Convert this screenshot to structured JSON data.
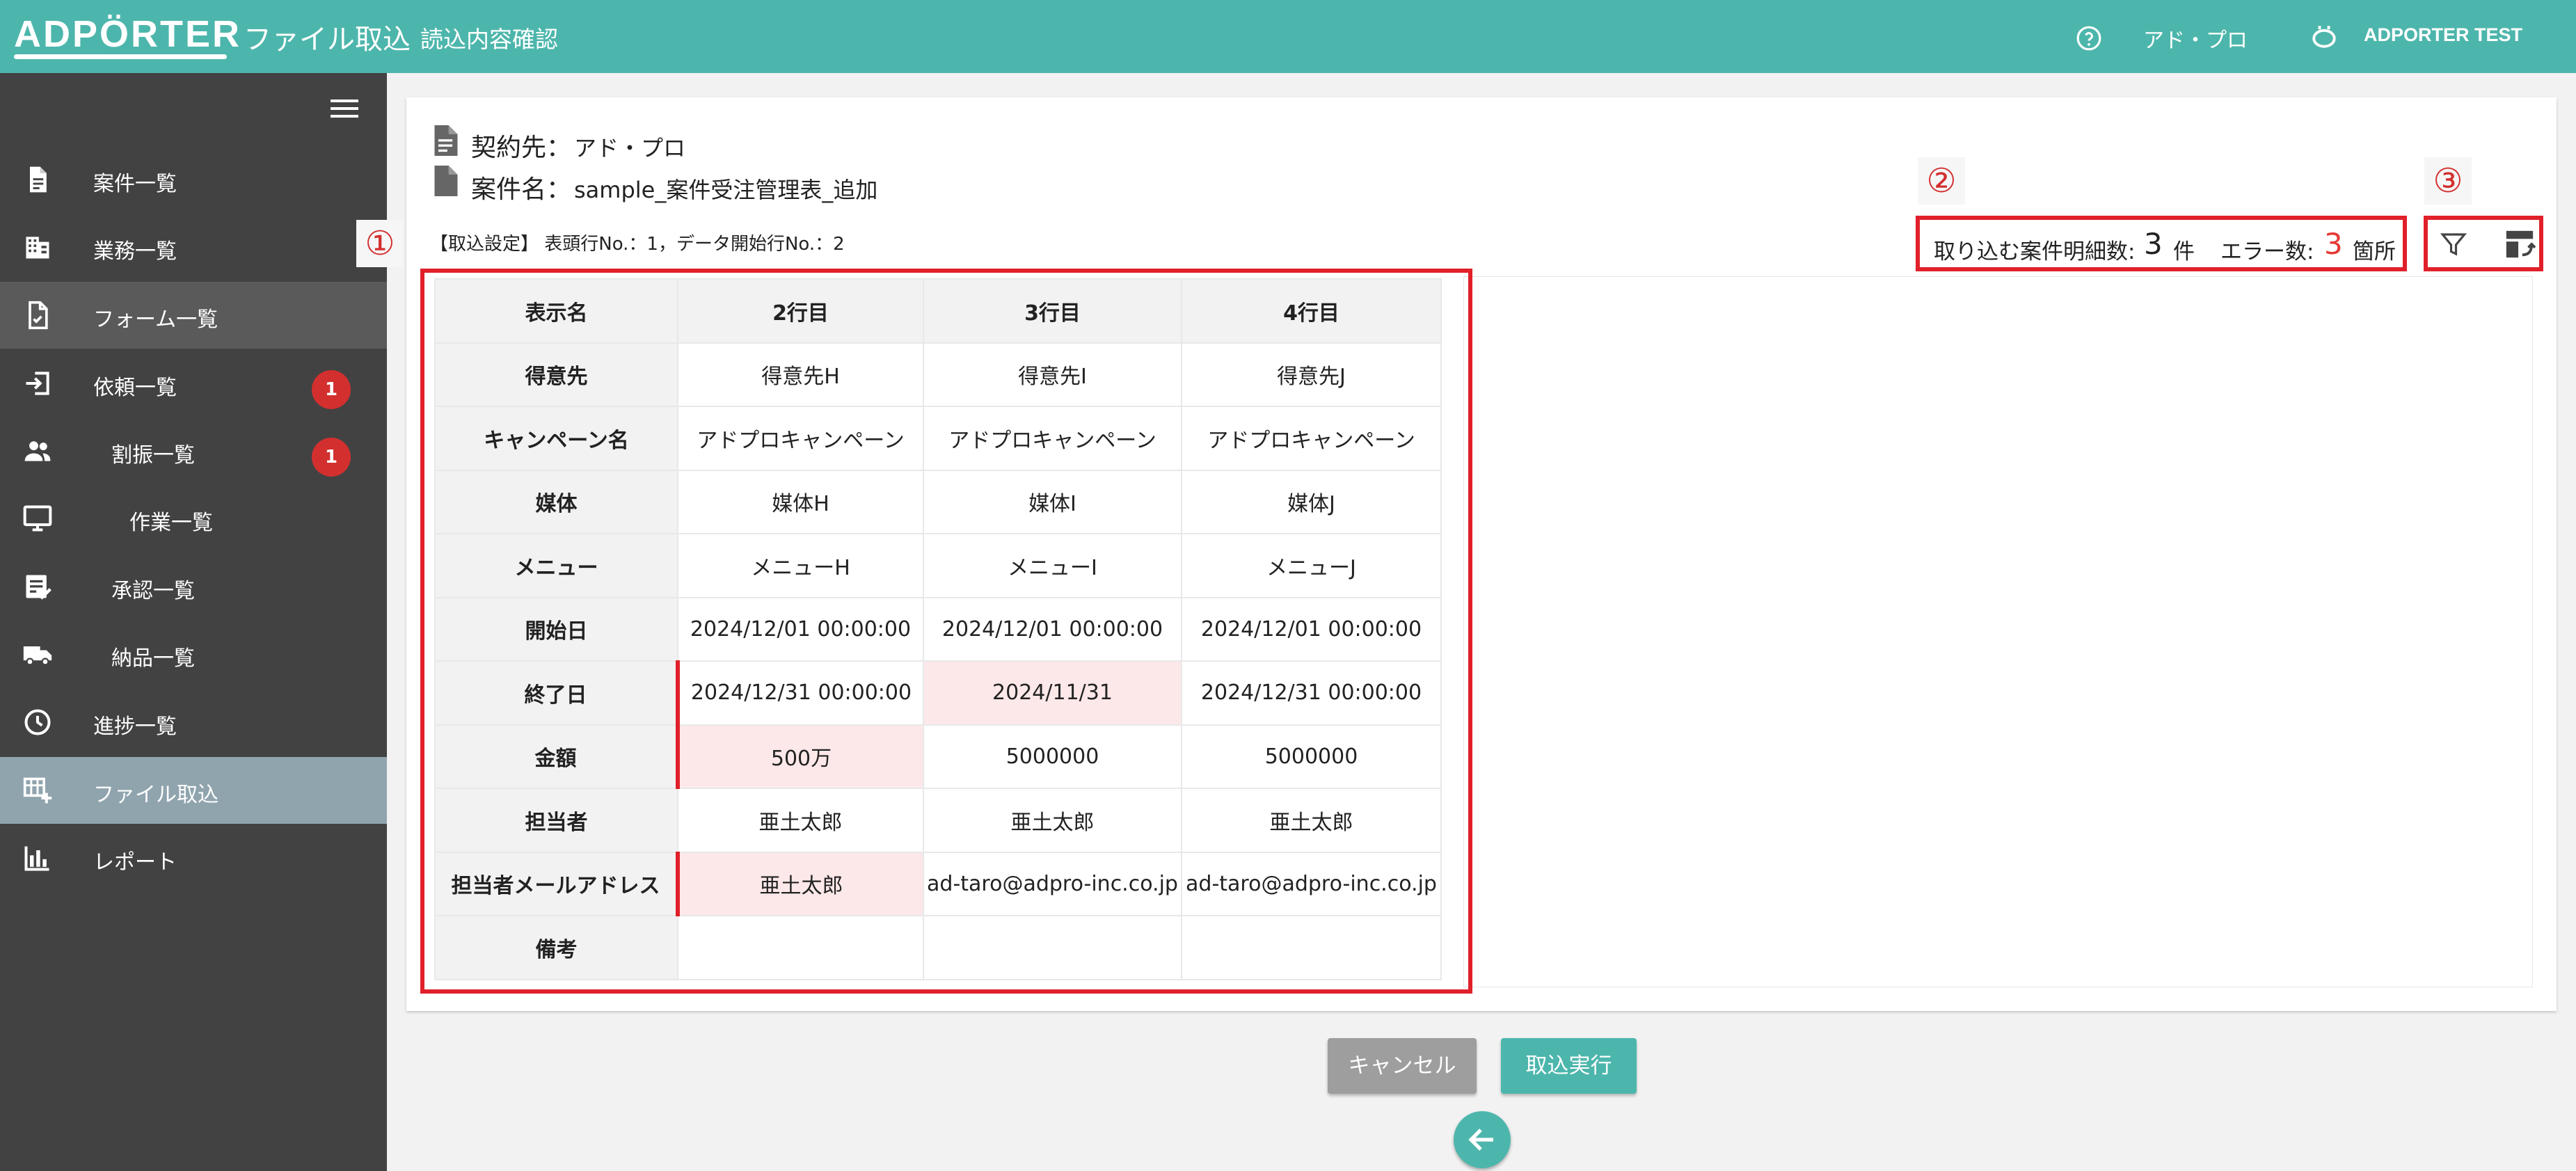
{
  "header": {
    "logo": "ADPÖRTER",
    "title": "ファイル取込",
    "subtitle": "読込内容確認",
    "client": "アド・プロ",
    "user": "ADPORTER TEST"
  },
  "sidebar": {
    "items": [
      {
        "label": "案件一覧",
        "icon": "document-icon"
      },
      {
        "label": "業務一覧",
        "icon": "building-icon"
      },
      {
        "label": "フォーム一覧",
        "icon": "form-icon"
      },
      {
        "label": "依頼一覧",
        "icon": "login-icon",
        "badge": "1"
      },
      {
        "label": "割振一覧",
        "icon": "people-icon",
        "badge": "1"
      },
      {
        "label": "作業一覧",
        "icon": "monitor-icon"
      },
      {
        "label": "承認一覧",
        "icon": "approval-icon"
      },
      {
        "label": "納品一覧",
        "icon": "truck-icon"
      },
      {
        "label": "進捗一覧",
        "icon": "clock-icon"
      },
      {
        "label": "ファイル取込",
        "icon": "table-add-icon"
      },
      {
        "label": "レポート",
        "icon": "chart-icon"
      }
    ]
  },
  "info": {
    "contract_label": "契約先：",
    "contract_value": "アド・プロ",
    "project_label": "案件名：",
    "project_value": "sample_案件受注管理表_追加",
    "settings": "【取込設定】 表頭行No.：1，データ開始行No.：2"
  },
  "markers": {
    "m1": "①",
    "m2": "②",
    "m3": "③"
  },
  "counts": {
    "detail_label": "取り込む案件明細数:",
    "detail_value": "3",
    "detail_unit": "件",
    "error_label": "エラー数:",
    "error_value": "3",
    "error_unit": "箇所",
    "error_color": "#e53935"
  },
  "table": {
    "header": [
      "表示名",
      "2行目",
      "3行目",
      "4行目"
    ],
    "rows": [
      {
        "label": "得意先",
        "cells": [
          "得意先H",
          "得意先I",
          "得意先J"
        ]
      },
      {
        "label": "キャンペーン名",
        "cells": [
          "アドプロキャンペーン",
          "アドプロキャンペーン",
          "アドプロキャンペーン"
        ]
      },
      {
        "label": "媒体",
        "cells": [
          "媒体H",
          "媒体I",
          "媒体J"
        ]
      },
      {
        "label": "メニュー",
        "cells": [
          "メニューH",
          "メニューI",
          "メニューJ"
        ]
      },
      {
        "label": "開始日",
        "cells": [
          "2024/12/01 00:00:00",
          "2024/12/01 00:00:00",
          "2024/12/01 00:00:00"
        ]
      },
      {
        "label": "終了日",
        "cells": [
          "2024/12/31 00:00:00",
          "2024/11/31",
          "2024/12/31 00:00:00"
        ]
      },
      {
        "label": "金額",
        "cells": [
          "500万",
          "5000000",
          "5000000"
        ]
      },
      {
        "label": "担当者",
        "cells": [
          "亜土太郎",
          "亜土太郎",
          "亜土太郎"
        ]
      },
      {
        "label": "担当者メールアドレス",
        "cells": [
          "亜土太郎",
          "ad-taro@adpro-inc.co.jp",
          "ad-taro@adpro-inc.co.jp"
        ]
      },
      {
        "label": "備考",
        "cells": [
          "",
          "",
          ""
        ]
      }
    ],
    "error_cells": [
      "終了日/3行目",
      "金額/2行目",
      "担当者メールアドレス/2行目"
    ],
    "error_bg": "#fde8e9",
    "error_bar": "#e0202a"
  },
  "buttons": {
    "cancel": "キャンセル",
    "execute": "取込実行",
    "back_icon": "arrow-left-icon"
  },
  "colors": {
    "accent": "#4db6ac",
    "sidebar": "#424242",
    "selected": "#90a4ae",
    "badge": "#d32f2f"
  }
}
